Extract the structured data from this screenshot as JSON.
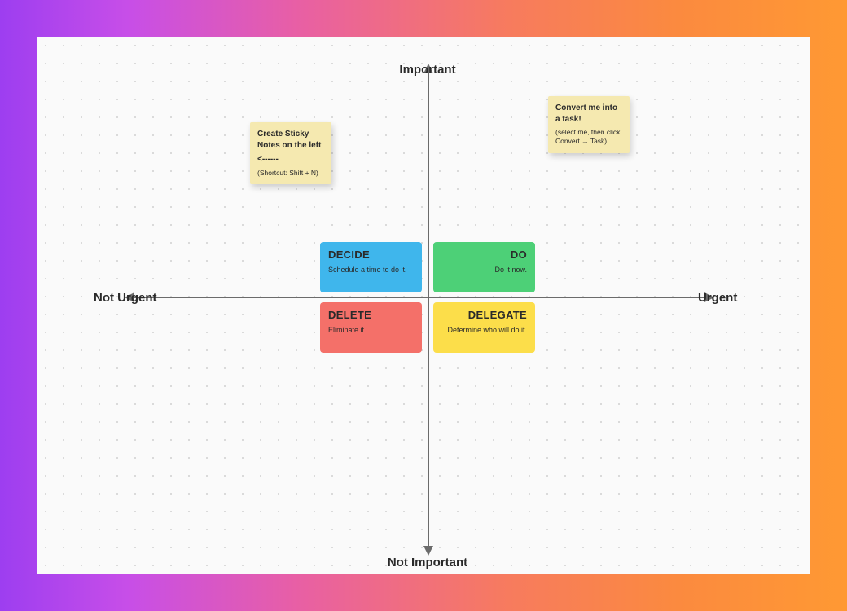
{
  "axes": {
    "top": "Important",
    "bottom": "Not Important",
    "left": "Not Urgent",
    "right": "Urgent"
  },
  "quadrants": {
    "decide": {
      "title": "DECIDE",
      "subtitle": "Schedule a time to do it.",
      "color": "#3fb6ec"
    },
    "do": {
      "title": "DO",
      "subtitle": "Do it now.",
      "color": "#4dd077"
    },
    "delete": {
      "title": "DELETE",
      "subtitle": "Eliminate it.",
      "color": "#f47069"
    },
    "delegate": {
      "title": "DELEGATE",
      "subtitle": "Determine who will do it.",
      "color": "#fcde4a"
    }
  },
  "stickies": {
    "s1": {
      "line1": "Create Sticky Notes on the left",
      "line2": "<------",
      "line3": "(Shortcut: Shift + N)"
    },
    "s2": {
      "line1": "Convert me into a task!",
      "line2": "(select me, then click Convert → Task)"
    }
  }
}
